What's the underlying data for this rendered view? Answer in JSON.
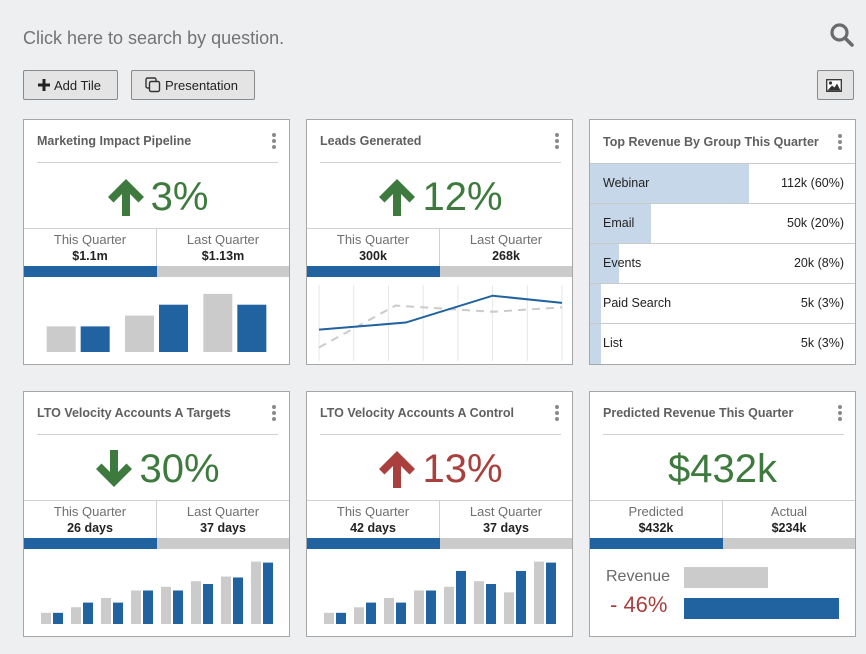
{
  "search": {
    "placeholder": "Click here to search by question."
  },
  "toolbar": {
    "add_tile_label": "Add Tile",
    "presentation_label": "Presentation"
  },
  "colors": {
    "accent_blue": "#2162a1",
    "compare_gray": "#cbcbcb",
    "positive_green": "#3e7a3d",
    "negative_red": "#a9403d",
    "rev_fill": "#c5d7e8"
  },
  "tiles": {
    "pipeline": {
      "title": "Marketing Impact Pipeline",
      "trend": "up",
      "trend_color": "green",
      "kpi": "3%",
      "this_label": "This Quarter",
      "this_value": "$1.1m",
      "last_label": "Last Quarter",
      "last_value": "$1.13m",
      "progress_fraction": 0.5,
      "chart_data": {
        "type": "bar",
        "categories": [
          "1",
          "2",
          "3"
        ],
        "series": [
          {
            "name": "Last Quarter",
            "color": "#cbcbcb",
            "values": [
              26,
              37,
              59
            ]
          },
          {
            "name": "This Quarter",
            "color": "#2162a1",
            "values": [
              26,
              48,
              48
            ]
          }
        ],
        "ylim": [
          0,
          68
        ]
      }
    },
    "leads": {
      "title": "Leads Generated",
      "trend": "up",
      "trend_color": "green",
      "kpi": "12%",
      "this_label": "This Quarter",
      "this_value": "300k",
      "last_label": "Last Quarter",
      "last_value": "268k",
      "progress_fraction": 0.5,
      "chart_data": {
        "type": "line",
        "x": [
          0,
          1,
          2,
          3,
          4,
          5,
          6,
          7
        ],
        "series": [
          {
            "name": "This Quarter",
            "style": "solid",
            "color": "#2162a1",
            "x": [
              0,
              2.5,
              5,
              7
            ],
            "values": [
              25,
              33,
              63,
              55
            ]
          },
          {
            "name": "Last Quarter",
            "style": "dashed",
            "color": "#cbcbcb",
            "x": [
              0,
              2.2,
              5,
              7
            ],
            "values": [
              5,
              52,
              45,
              50
            ]
          }
        ],
        "ylim": [
          0,
          75
        ]
      }
    },
    "top_revenue": {
      "title": "Top Revenue By Group This Quarter",
      "rows": [
        {
          "label": "Webinar",
          "value": "112k (60%)",
          "fraction": 0.6
        },
        {
          "label": "Email",
          "value": "50k (20%)",
          "fraction": 0.23
        },
        {
          "label": "Events",
          "value": "20k (8%)",
          "fraction": 0.11
        },
        {
          "label": "Paid Search",
          "value": "5k (3%)",
          "fraction": 0.04
        },
        {
          "label": "List",
          "value": "5k (3%)",
          "fraction": 0.04
        }
      ]
    },
    "lto_targets": {
      "title": "LTO Velocity Accounts A Targets",
      "trend": "down",
      "trend_color": "green",
      "kpi": "30%",
      "this_label": "This Quarter",
      "this_value": "26 days",
      "last_label": "Last Quarter",
      "last_value": "37 days",
      "progress_fraction": 0.5,
      "chart_data": {
        "type": "bar",
        "categories": [
          "1",
          "2",
          "3",
          "4",
          "5",
          "6",
          "7",
          "8"
        ],
        "series": [
          {
            "name": "Last Quarter",
            "color": "#cbcbcb",
            "values": [
              12,
              18,
              28,
              36,
              40,
              46,
              51,
              67
            ]
          },
          {
            "name": "This Quarter",
            "color": "#2162a1",
            "values": [
              12,
              23,
              23,
              36,
              36,
              43,
              50,
              66
            ]
          }
        ],
        "ylim": [
          0,
          72
        ]
      }
    },
    "lto_control": {
      "title": "LTO Velocity Accounts A Control",
      "trend": "up",
      "trend_color": "red",
      "kpi": "13%",
      "this_label": "This Quarter",
      "this_value": "42 days",
      "last_label": "Last Quarter",
      "last_value": "37 days",
      "progress_fraction": 0.5,
      "chart_data": {
        "type": "bar",
        "categories": [
          "1",
          "2",
          "3",
          "4",
          "5",
          "6",
          "7",
          "8"
        ],
        "series": [
          {
            "name": "Last Quarter",
            "color": "#cbcbcb",
            "values": [
              12,
              18,
              28,
              36,
              40,
              46,
              34,
              67
            ]
          },
          {
            "name": "This Quarter",
            "color": "#2162a1",
            "values": [
              12,
              23,
              23,
              36,
              57,
              43,
              57,
              66
            ]
          }
        ],
        "ylim": [
          0,
          72
        ]
      }
    },
    "predicted": {
      "title": "Predicted Revenue This Quarter",
      "kpi": "$432k",
      "this_label": "Predicted",
      "this_value": "$432k",
      "last_label": "Actual",
      "last_value": "$234k",
      "progress_fraction": 0.5,
      "compare_label": "Revenue",
      "compare_pct": "- 46%",
      "chart_data": {
        "type": "bar",
        "categories": [
          "Actual",
          "Predicted"
        ],
        "values": [
          234,
          432
        ],
        "orientation": "horizontal"
      }
    }
  }
}
